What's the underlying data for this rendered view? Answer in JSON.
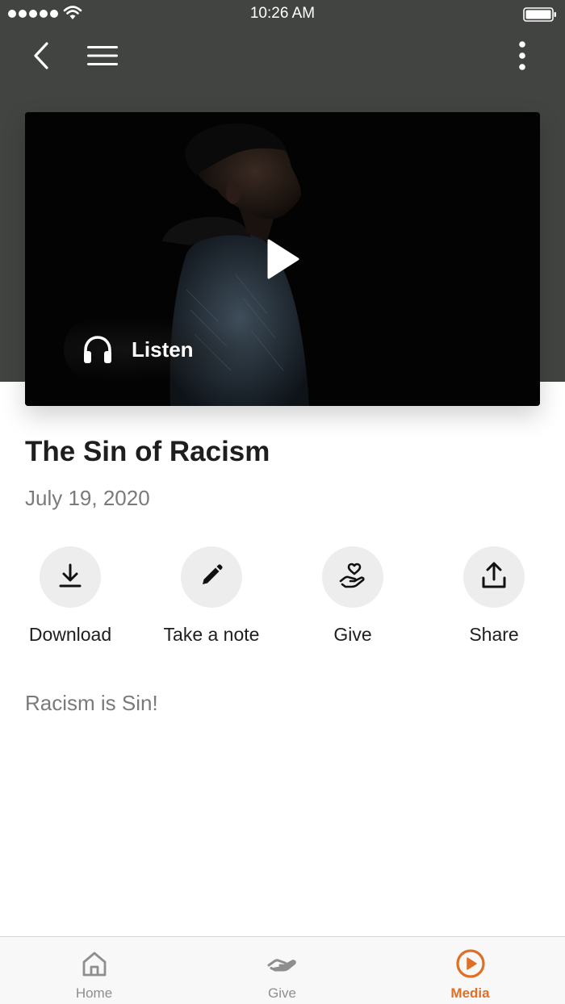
{
  "status": {
    "time": "10:26 AM"
  },
  "media": {
    "listen_label": "Listen",
    "title": "The Sin of Racism",
    "date": "July 19, 2020",
    "description": "Racism is Sin!"
  },
  "actions": [
    {
      "label": "Download",
      "icon": "download-icon"
    },
    {
      "label": "Take a note",
      "icon": "pencil-icon"
    },
    {
      "label": "Give",
      "icon": "give-heart-hand-icon"
    },
    {
      "label": "Share",
      "icon": "share-icon"
    }
  ],
  "tabs": [
    {
      "label": "Home",
      "icon": "home-icon",
      "active": false
    },
    {
      "label": "Give",
      "icon": "give-hand-icon",
      "active": false
    },
    {
      "label": "Media",
      "icon": "play-circle-icon",
      "active": true
    }
  ],
  "colors": {
    "header": "#414441",
    "accent": "#e06f25",
    "action_bg": "#ededed"
  }
}
